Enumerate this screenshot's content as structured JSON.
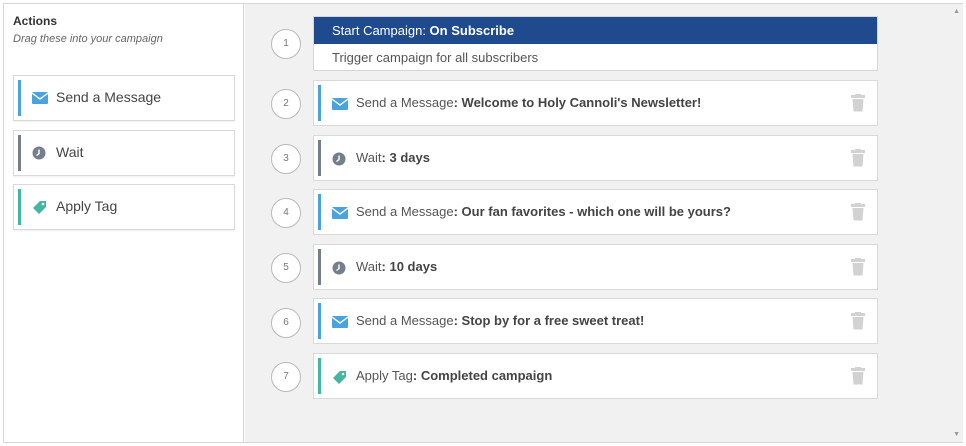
{
  "sidebar": {
    "title": "Actions",
    "subtitle": "Drag these into your campaign",
    "items": [
      {
        "label": "Send a Message",
        "icon": "envelope-icon",
        "color": "#4aa3df"
      },
      {
        "label": "Wait",
        "icon": "clock-icon",
        "color": "#757f8c"
      },
      {
        "label": "Apply Tag",
        "icon": "tag-icon",
        "color": "#43b5a0"
      }
    ]
  },
  "campaign": {
    "trigger": {
      "number": "1",
      "head_prefix": "Start Campaign: ",
      "head_value": "On Subscribe",
      "body": "Trigger campaign for all subscribers",
      "color": "#1f4b8e"
    },
    "steps": [
      {
        "number": "2",
        "type": "Send a Message",
        "sep": ": ",
        "value": "Welcome to Holy Cannoli's Newsletter!",
        "icon": "envelope-icon",
        "color": "#4aa3df"
      },
      {
        "number": "3",
        "type": "Wait",
        "sep": ": ",
        "value": "3 days",
        "icon": "clock-icon",
        "color": "#757f8c"
      },
      {
        "number": "4",
        "type": "Send a Message",
        "sep": ": ",
        "value": "Our fan favorites - which one will be yours?",
        "icon": "envelope-icon",
        "color": "#4aa3df"
      },
      {
        "number": "5",
        "type": "Wait",
        "sep": ": ",
        "value": "10 days",
        "icon": "clock-icon",
        "color": "#757f8c"
      },
      {
        "number": "6",
        "type": "Send a Message",
        "sep": ": ",
        "value": "Stop by for a free sweet treat!",
        "icon": "envelope-icon",
        "color": "#4aa3df"
      },
      {
        "number": "7",
        "type": "Apply Tag",
        "sep": ": ",
        "value": "Completed campaign",
        "icon": "tag-icon",
        "color": "#43b5a0"
      }
    ]
  }
}
